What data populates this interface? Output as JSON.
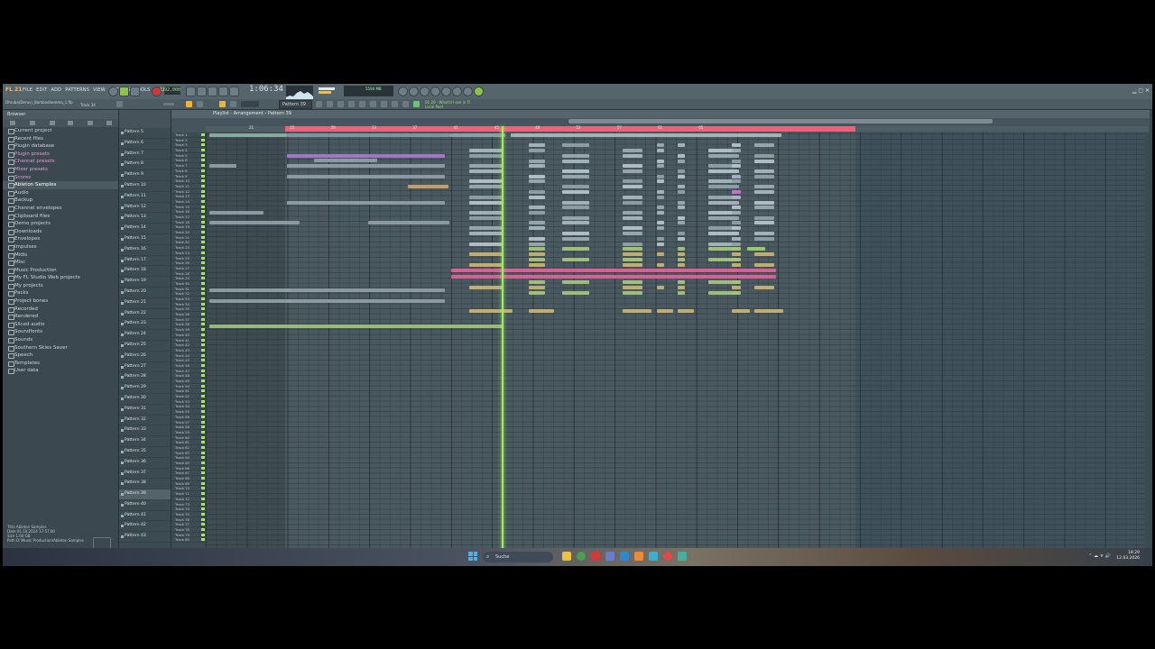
{
  "app": {
    "logo": "FL 21",
    "menu": [
      "FILE",
      "EDIT",
      "ADD",
      "PATTERNS",
      "VIEW",
      "OPTIONS",
      "TOOLS",
      "HELP"
    ],
    "tempo": "92.000",
    "time": "1:06:34",
    "pattern_name": "Pattern 39",
    "cpu_text": "5594 MB",
    "window_controls": "▁ ▢ ✕",
    "hint_line1": "Dhruba(Deruv)_Bamboohemma_1.flp",
    "hint_line2": "Track 34",
    "song_info_line1": "01:20 - What'd I see in Tl",
    "song_info_line2": "Local Post",
    "accent_color": "#f0b432"
  },
  "browser": {
    "title": "Browser",
    "items": [
      {
        "label": "Current project",
        "style": "normal"
      },
      {
        "label": "Recent files",
        "style": "normal"
      },
      {
        "label": "Plugin database",
        "style": "normal"
      },
      {
        "label": "Plugin presets",
        "style": "pink"
      },
      {
        "label": "Channel presets",
        "style": "pink"
      },
      {
        "label": "Mixer presets",
        "style": "pink"
      },
      {
        "label": "Scores",
        "style": "pink"
      },
      {
        "label": "Ableton Samples",
        "style": "sel"
      },
      {
        "label": "Audio",
        "style": "normal"
      },
      {
        "label": "Backup",
        "style": "normal"
      },
      {
        "label": "Channel envelopes",
        "style": "normal"
      },
      {
        "label": "Clipboard files",
        "style": "normal"
      },
      {
        "label": "Demo projects",
        "style": "normal"
      },
      {
        "label": "Downloads",
        "style": "normal"
      },
      {
        "label": "Envelopes",
        "style": "normal"
      },
      {
        "label": "Impulses",
        "style": "normal"
      },
      {
        "label": "Midis",
        "style": "normal"
      },
      {
        "label": "Misc",
        "style": "normal"
      },
      {
        "label": "Music Production",
        "style": "normal"
      },
      {
        "label": "My FL Studio Web projects",
        "style": "normal"
      },
      {
        "label": "My projects",
        "style": "normal"
      },
      {
        "label": "Packs",
        "style": "normal"
      },
      {
        "label": "Project bones",
        "style": "normal"
      },
      {
        "label": "Recorded",
        "style": "normal"
      },
      {
        "label": "Rendered",
        "style": "normal"
      },
      {
        "label": "Sliced audio",
        "style": "normal"
      },
      {
        "label": "Soundfonts",
        "style": "normal"
      },
      {
        "label": "Sounds",
        "style": "normal"
      },
      {
        "label": "Southern Skies Saver",
        "style": "normal"
      },
      {
        "label": "Speech",
        "style": "normal"
      },
      {
        "label": "Templates",
        "style": "normal"
      },
      {
        "label": "User data",
        "style": "normal"
      }
    ],
    "info": {
      "title": "Title  Ableton Samples",
      "date": "Date   01.10.2024 17:57:00",
      "size": "Size   1.60 GB",
      "path": "Path   D:\\Music Production\\Ableton Samples"
    },
    "footer": "1400"
  },
  "patterns": {
    "items": [
      "Pattern 5",
      "Pattern 6",
      "Pattern 7",
      "Pattern 8",
      "Pattern 9",
      "Pattern 10",
      "Pattern 11",
      "Pattern 12",
      "Pattern 13",
      "Pattern 14",
      "Pattern 15",
      "Pattern 16",
      "Pattern 17",
      "Pattern 18",
      "Pattern 19",
      "Pattern 20",
      "Pattern 21",
      "Pattern 22",
      "Pattern 23",
      "Pattern 24",
      "Pattern 25",
      "Pattern 26",
      "Pattern 27",
      "Pattern 28",
      "Pattern 29",
      "Pattern 30",
      "Pattern 31",
      "Pattern 32",
      "Pattern 33",
      "Pattern 34",
      "Pattern 35",
      "Pattern 36",
      "Pattern 37",
      "Pattern 38",
      "Pattern 39",
      "Pattern 40",
      "Pattern 41",
      "Pattern 42",
      "Pattern 43"
    ],
    "selected": "Pattern 39"
  },
  "playlist": {
    "title": "Playlist - Arrangement › Pattern 39",
    "bar_numbers": [
      "21",
      "25",
      "29",
      "33",
      "37",
      "41",
      "45",
      "49",
      "53",
      "57",
      "61",
      "65"
    ],
    "track_count": 80
  },
  "taskbar": {
    "search_placeholder": "Suche",
    "time": "18:29",
    "date": "12.03.2026",
    "tray": "⌃ ☁ ᯤ 🔊"
  }
}
